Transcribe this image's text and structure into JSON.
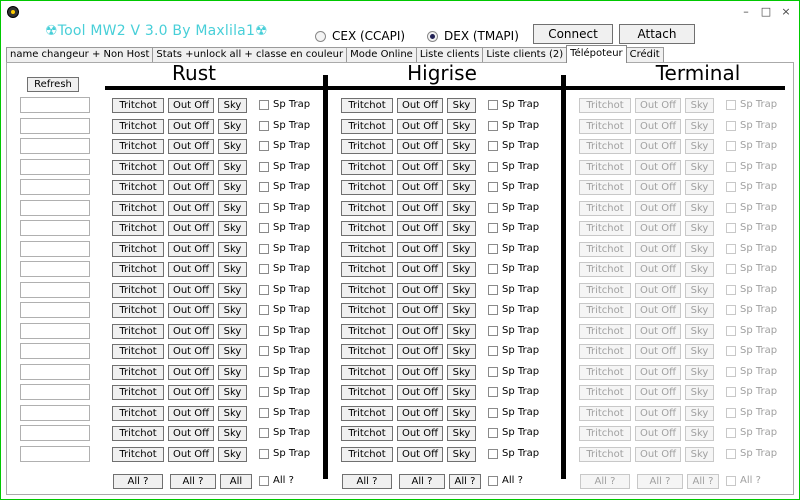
{
  "window": {
    "title": "☢Tool MW2 V 3.0  By Maxlila1☢",
    "controls": [
      "–",
      "□",
      "×"
    ]
  },
  "api": {
    "options": [
      {
        "label": "CEX (CCAPI)",
        "selected": false
      },
      {
        "label": "DEX (TMAPI)",
        "selected": true
      }
    ],
    "connect_label": "Connect",
    "attach_label": "Attach"
  },
  "tabs": [
    {
      "label": "name changeur + Non Host",
      "active": false
    },
    {
      "label": "Stats +unlock all + classe en couleur",
      "active": false
    },
    {
      "label": "Mode Online",
      "active": false
    },
    {
      "label": "Liste clients",
      "active": false
    },
    {
      "label": "Liste clients (2)",
      "active": false
    },
    {
      "label": "Télépoteur",
      "active": true
    },
    {
      "label": "Crédit",
      "active": false
    }
  ],
  "refresh_label": "Refresh",
  "row_count": 18,
  "row_buttons": {
    "tritchot": "Tritchot",
    "out_off": "Out Off",
    "sky": "Sky",
    "sp_trap": "Sp Trap"
  },
  "sections": [
    {
      "title": "Rust",
      "enabled": true,
      "all_buttons": [
        "All ?",
        "All ?",
        "All"
      ],
      "all_check": "All ?"
    },
    {
      "title": "Higrise",
      "enabled": true,
      "all_buttons": [
        "All ?",
        "All ?",
        "All ?"
      ],
      "all_check": "All ?"
    },
    {
      "title": "Terminal",
      "enabled": false,
      "all_buttons": [
        "All ?",
        "All ?",
        "All ?"
      ],
      "all_check": "All ?"
    }
  ]
}
